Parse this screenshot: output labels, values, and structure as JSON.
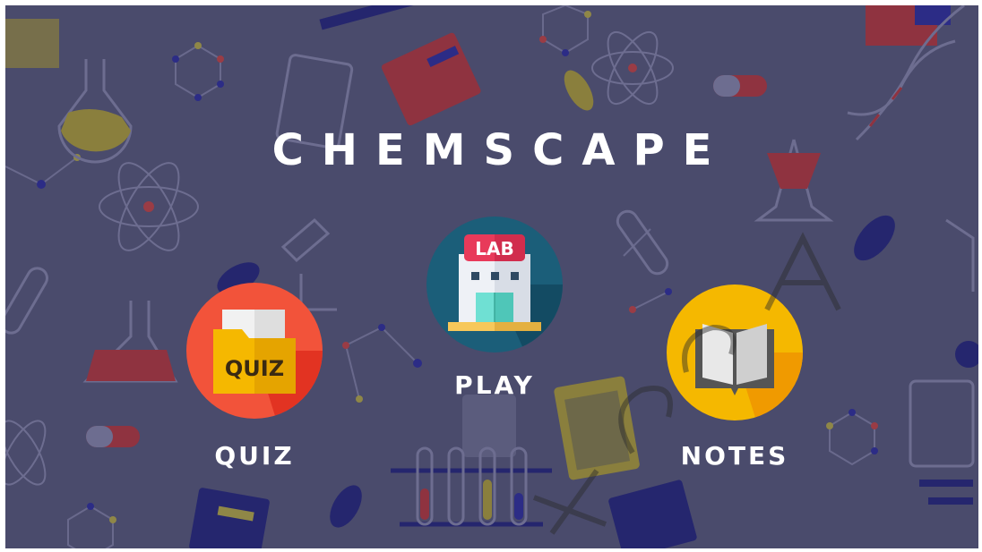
{
  "game": {
    "title": "CHEMSCAPE"
  },
  "menu": {
    "play": {
      "label": "PLAY",
      "icon": "lab-building-icon",
      "badge_text": "LAB"
    },
    "quiz": {
      "label": "QUIZ",
      "icon": "quiz-folder-icon",
      "badge_text": "QUIZ"
    },
    "notes": {
      "label": "NOTES",
      "icon": "open-book-icon"
    }
  },
  "colors": {
    "background": "#4a4b6c",
    "play_circle": "#1b5e79",
    "quiz_circle": "#f2533a",
    "notes_circle": "#f5b800",
    "text": "#ffffff"
  }
}
